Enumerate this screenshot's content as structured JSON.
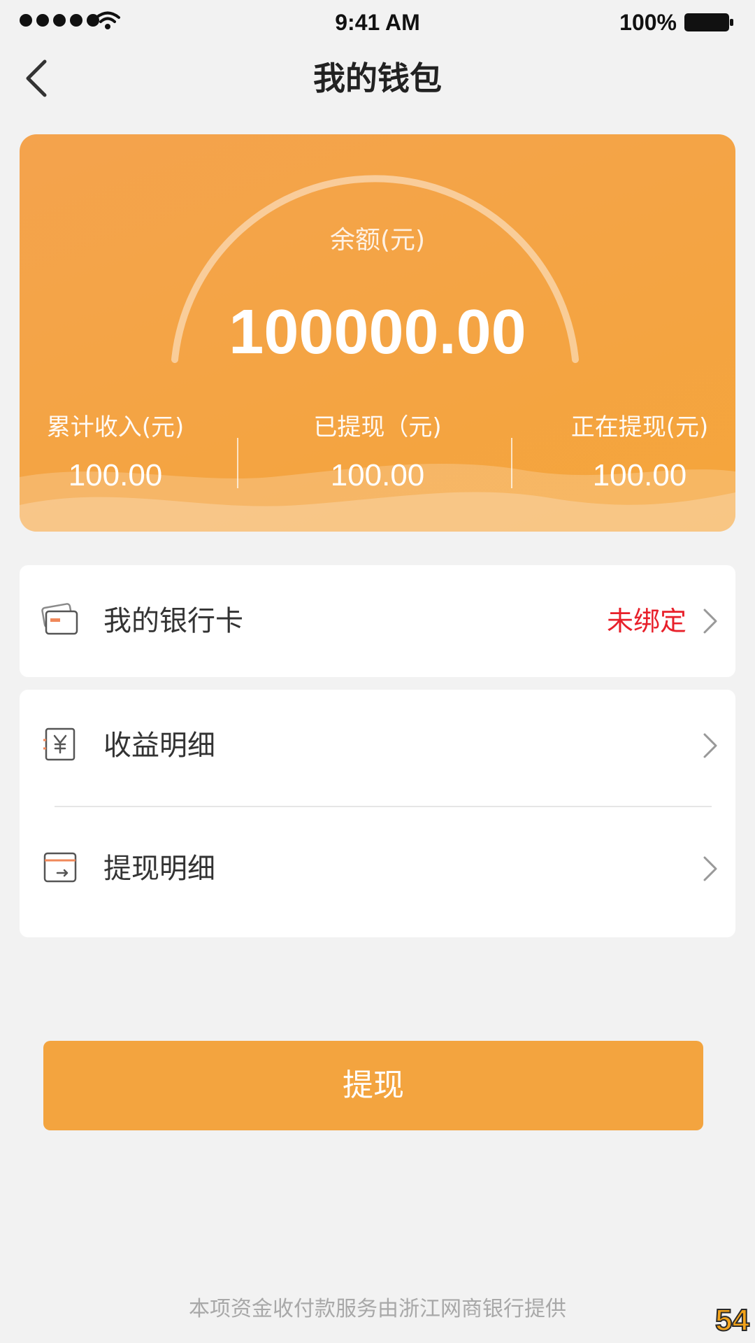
{
  "status_bar": {
    "time": "9:41 AM",
    "battery_percent": "100%"
  },
  "nav": {
    "title": "我的钱包"
  },
  "balance_card": {
    "balance_label": "余额(元)",
    "balance_amount": "100000.00",
    "stats": [
      {
        "label": "累计收入(元)",
        "value": "100.00"
      },
      {
        "label": "已提现（元)",
        "value": "100.00"
      },
      {
        "label": "正在提现(元)",
        "value": "100.00"
      }
    ]
  },
  "menu": {
    "bank_card": {
      "label": "我的银行卡",
      "status": "未绑定",
      "icon": "bank-card-icon"
    },
    "income_detail": {
      "label": "收益明细",
      "icon": "yuan-icon"
    },
    "withdraw_detail": {
      "label": "提现明细",
      "icon": "withdraw-icon"
    }
  },
  "withdraw_button": {
    "label": "提现"
  },
  "footer": {
    "note": "本项资金收付款服务由浙江网商银行提供"
  },
  "watermark": {
    "text": "54"
  },
  "colors": {
    "accent": "#f3a43f",
    "status_red": "#e8202a",
    "background": "#f2f2f2"
  }
}
